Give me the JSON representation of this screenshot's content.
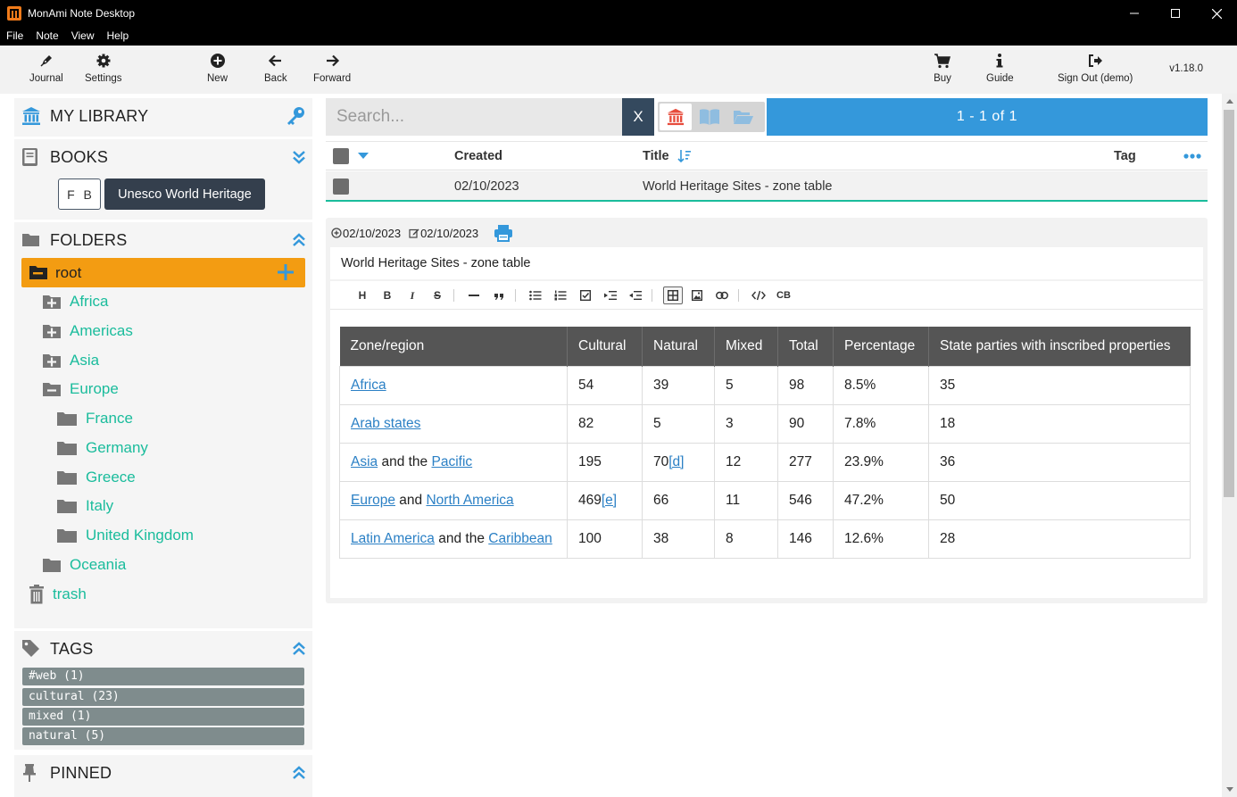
{
  "window": {
    "title": "MonAmi Note Desktop"
  },
  "menu": [
    "File",
    "Note",
    "View",
    "Help"
  ],
  "toolbar": {
    "journal": "Journal",
    "settings": "Settings",
    "new": "New",
    "back": "Back",
    "forward": "Forward",
    "buy": "Buy",
    "guide": "Guide",
    "signout": "Sign Out (demo)",
    "version": "v1.18.0"
  },
  "sidebar": {
    "library_title": "MY LIBRARY",
    "books_title": "BOOKS",
    "book_fb": "F B",
    "book_active": "Unesco World Heritage",
    "folders_title": "FOLDERS",
    "root": "root",
    "folders": {
      "africa": "Africa",
      "americas": "Americas",
      "asia": "Asia",
      "europe": "Europe",
      "france": "France",
      "germany": "Germany",
      "greece": "Greece",
      "italy": "Italy",
      "uk": "United Kingdom",
      "oceania": "Oceania"
    },
    "trash": "trash",
    "tags_title": "TAGS",
    "tags": [
      "#web (1)",
      "cultural (23)",
      "mixed (1)",
      "natural (5)"
    ],
    "pinned_title": "PINNED"
  },
  "search": {
    "placeholder": "Search...",
    "clear": "X",
    "count": "1 - 1  of  1"
  },
  "list": {
    "col_created": "Created",
    "col_title": "Title",
    "col_tag": "Tag",
    "row_created": "02/10/2023",
    "row_title": "World Heritage Sites - zone table"
  },
  "note": {
    "created": "02/10/2023",
    "modified": "02/10/2023",
    "title": "World Heritage Sites - zone table",
    "toolbar": {
      "h": "H",
      "b": "B",
      "i": "I",
      "s": "S",
      "cb": "CB"
    },
    "table": {
      "headers": [
        "Zone/region",
        "Cultural",
        "Natural",
        "Mixed",
        "Total",
        "Percentage",
        "State parties with inscribed properties"
      ],
      "rows": [
        {
          "r1": "Africa",
          "cultural": "54",
          "natural": "39",
          "mixed": "5",
          "total": "98",
          "pct": "8.5%",
          "states": "35"
        },
        {
          "r1": "Arab states",
          "cultural": "82",
          "natural": "5",
          "mixed": "3",
          "total": "90",
          "pct": "7.8%",
          "states": "18"
        },
        {
          "r1": "Asia",
          "mid": " and the ",
          "r2": "Pacific",
          "cultural": "195",
          "natural": "70",
          "natural_note": "[d]",
          "mixed": "12",
          "total": "277",
          "pct": "23.9%",
          "states": "36"
        },
        {
          "r1": "Europe",
          "mid": " and ",
          "r2": "North America",
          "cultural": "469",
          "cultural_note": "[e]",
          "natural": "66",
          "mixed": "11",
          "total": "546",
          "pct": "47.2%",
          "states": "50"
        },
        {
          "r1": "Latin America",
          "mid": " and the ",
          "r2": "Caribbean",
          "cultural": "100",
          "natural": "38",
          "mixed": "8",
          "total": "146",
          "pct": "12.6%",
          "states": "28"
        }
      ]
    }
  },
  "colors": {
    "accent": "#3498db",
    "folder_active": "#f39c12",
    "link": "#1abc9c",
    "dark": "#34495e",
    "tag": "#7f8c8d"
  }
}
